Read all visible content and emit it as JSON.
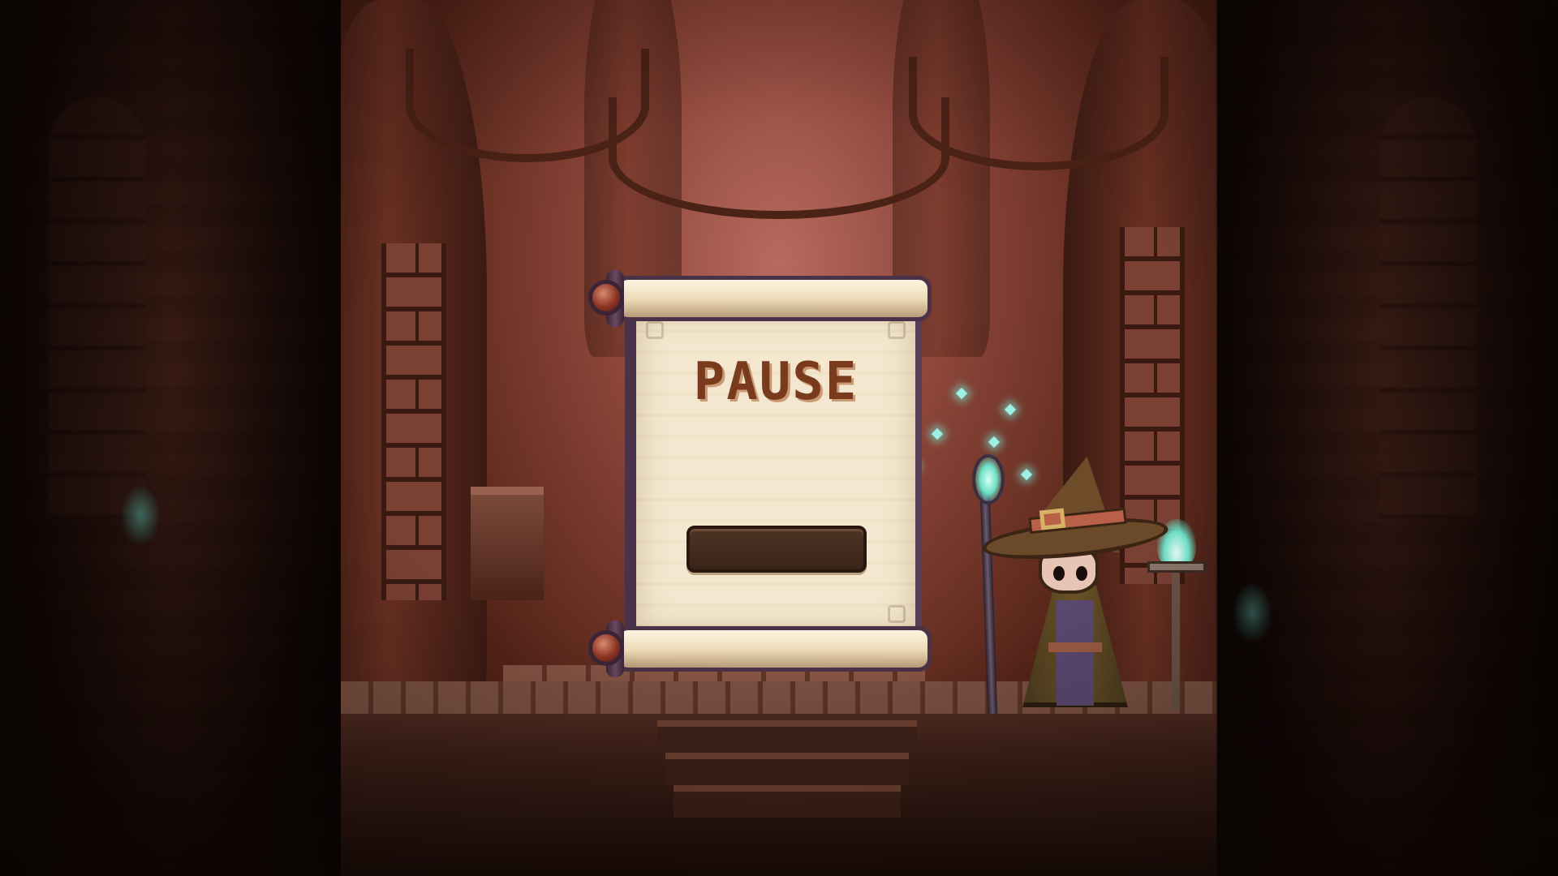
{
  "pause_menu": {
    "title": "PAUSE",
    "resume_button_label": ""
  },
  "colors": {
    "scroll_paper": "#f3e8cf",
    "title_text": "#7a3a1e",
    "button_fill": "#3a2418",
    "magic_glow": "#6ee0c8"
  },
  "icons": {
    "character": "wizard-icon",
    "staff": "magic-staff-icon",
    "brazier": "brazier-flame-icon"
  }
}
